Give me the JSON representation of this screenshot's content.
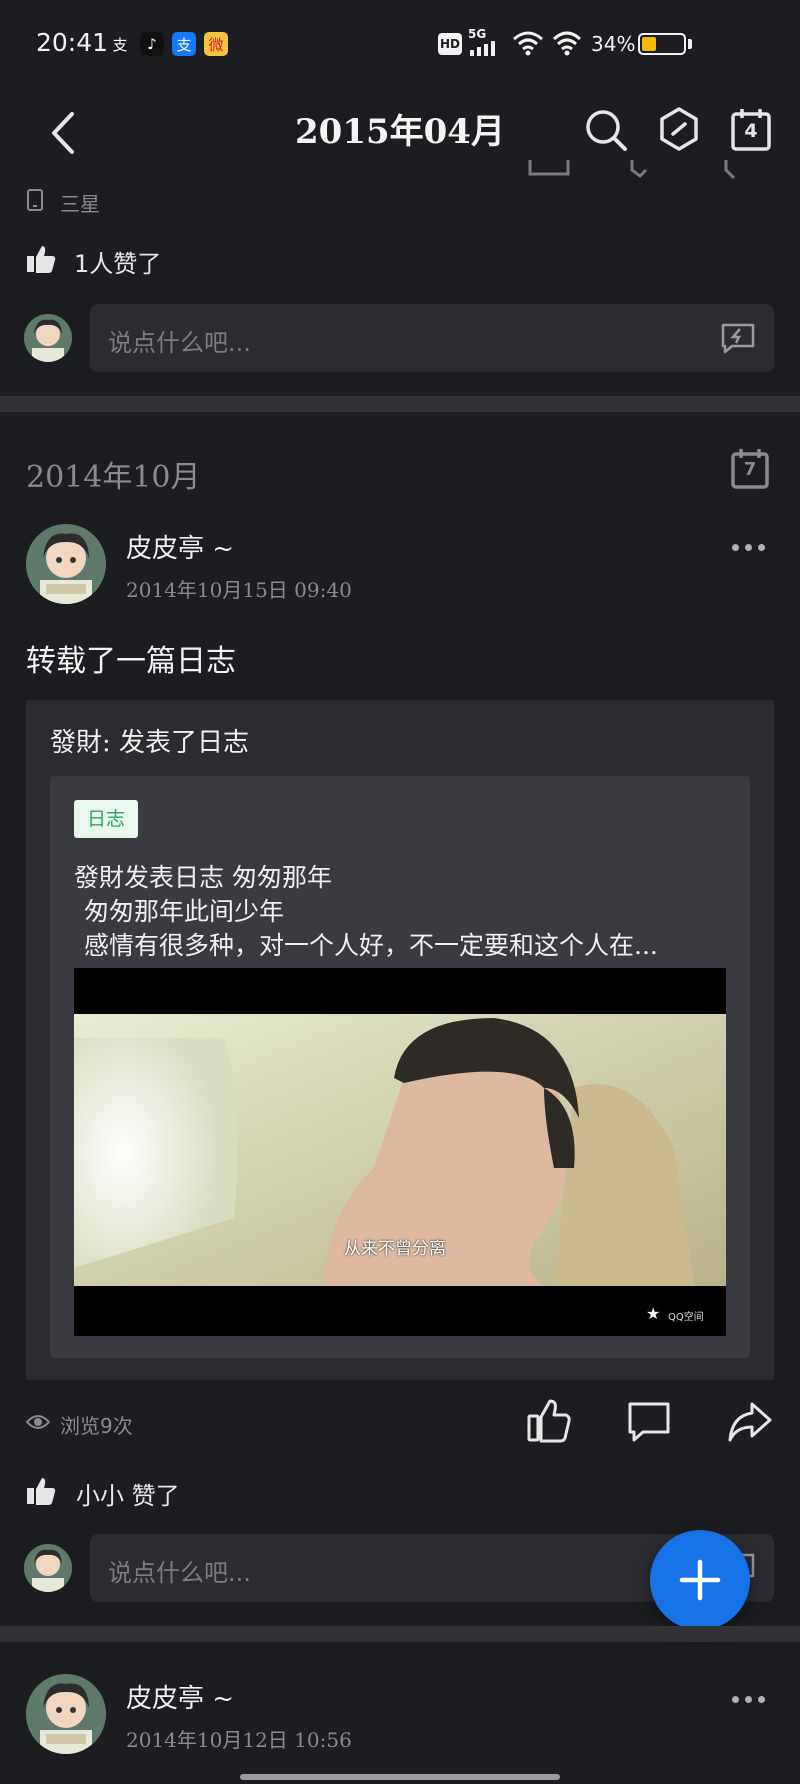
{
  "status_bar": {
    "time": "20:41",
    "app_icons": [
      {
        "name": "alipay-icon",
        "glyph": "支",
        "color": "#1c1d21",
        "text_color": "#ffffff"
      },
      {
        "name": "tiktok-icon",
        "glyph": "♪",
        "color": "#111111",
        "text_color": "#ffffff"
      },
      {
        "name": "alipay-blue-icon",
        "glyph": "支",
        "color": "#1677ff",
        "text_color": "#ffffff"
      },
      {
        "name": "weibo-icon",
        "glyph": "微",
        "color": "#f5c542",
        "text_color": "#e6162d"
      }
    ],
    "hd_label": "HD",
    "network_label": "5G",
    "battery_text": "34%",
    "battery_level": 0.34,
    "battery_color": "#f5b800"
  },
  "header": {
    "title": "2015年04月",
    "back_icon": "back-arrow-icon",
    "search_icon": "search-icon",
    "hexagon_icon": "hexagon-icon",
    "calendar_day": "4"
  },
  "post_prev": {
    "device": "三星",
    "likes_text": "1人赞了",
    "comment_placeholder": "说点什么吧..."
  },
  "section": {
    "month_label": "2014年10月",
    "calendar_day": "7"
  },
  "post1": {
    "author": "皮皮亭 ~",
    "datetime": "2014年10月15日  09:40",
    "content": "转载了一篇日志",
    "repost": {
      "source_name": "發財",
      "source_action": ": 发表了日志",
      "tag": "日志",
      "blog_title": "發財发表日志 匆匆那年",
      "line2": "匆匆那年此间少年",
      "line3": "感情有很多种，对一个人好，不一定要和这个人在...",
      "video_subtitle": "从来不曾分离",
      "video_watermark": "QQ空间"
    },
    "views": "浏览9次",
    "likes_text": "小小 赞了",
    "comment_placeholder": "说点什么吧..."
  },
  "post2": {
    "author": "皮皮亭 ~",
    "datetime": "2014年10月12日  10:56"
  },
  "colors": {
    "background": "#1c1d21",
    "separator": "#303236",
    "accent": "#1672e6",
    "tag_green": "#2aa660"
  }
}
